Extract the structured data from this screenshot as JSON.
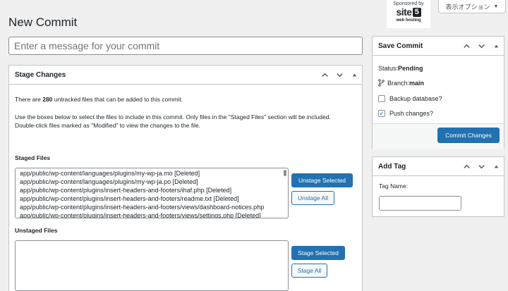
{
  "page": {
    "title": "New Commit"
  },
  "screen_options": {
    "label": "表示オプション"
  },
  "sponsor": {
    "text": "Sponsored by",
    "logo_word": "site",
    "logo_box": "5",
    "logo_sub": "web hosting"
  },
  "commit_message": {
    "placeholder": "Enter a message for your commit",
    "value": ""
  },
  "stage_box": {
    "title": "Stage Changes",
    "untracked_prefix": "There are ",
    "untracked_count": "280",
    "untracked_suffix": " untracked files that can be added to this commit.",
    "instructions_1": "Use the boxes below to select the files to include in this commit. Only files in the \"Staged Files\" section will be included.",
    "instructions_2": "Double-click files marked as \"Modified\" to view the changes to the file.",
    "staged_heading": "Staged Files",
    "staged_files": [
      "app/public/wp-content/languages/plugins/my-wp-ja.mo [Deleted]",
      "app/public/wp-content/languages/plugins/my-wp-ja.po [Deleted]",
      "app/public/wp-content/plugins/insert-headers-and-footers/ihaf.php [Deleted]",
      "app/public/wp-content/plugins/insert-headers-and-footers/readme.txt [Deleted]",
      "app/public/wp-content/plugins/insert-headers-and-footers/views/dashboard-notices.php",
      "app/public/wp-content/plugins/insert-headers-and-footers/views/settings.php [Deleted]"
    ],
    "unstage_selected": "Unstage Selected",
    "unstage_all": "Unstage All",
    "unstaged_heading": "Unstaged Files",
    "stage_selected": "Stage Selected",
    "stage_all": "Stage All"
  },
  "save_box": {
    "title": "Save Commit",
    "status_label": "Status: ",
    "status_value": "Pending",
    "branch_label": "Branch: ",
    "branch_value": "main",
    "backup_label": "Backup database?",
    "backup_checked": false,
    "push_label": "Push changes?",
    "push_checked": true,
    "commit_button": "Commit Changes"
  },
  "tag_box": {
    "title": "Add Tag",
    "tag_name_label": "Tag Name:",
    "tag_value": ""
  },
  "colors": {
    "primary": "#2271b1",
    "border": "#c3c4c7",
    "background": "#f0f0f1"
  }
}
